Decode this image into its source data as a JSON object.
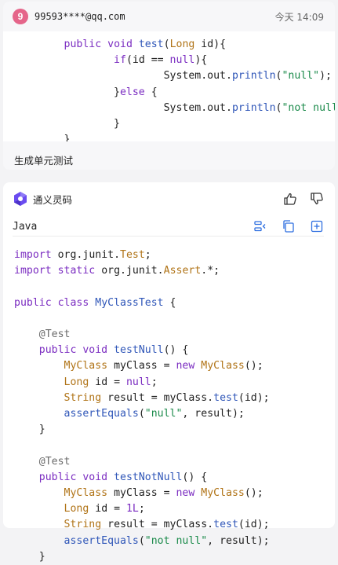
{
  "message": {
    "avatar_text": "9",
    "email": "99593****@qq.com",
    "time": "今天 14:09",
    "prompt": "生成单元测试"
  },
  "assistant": {
    "name": "通义灵码",
    "language": "Java"
  },
  "colors": {
    "keyword": "#7b2dc1",
    "function": "#2f56b8",
    "type": "#b07316",
    "string": "#1a8a4a",
    "avatar": "#e5658a"
  },
  "icons": [
    "thumbs-up-icon",
    "thumbs-down-icon",
    "insert-code-icon",
    "copy-icon",
    "new-file-icon",
    "tongyi-logo-icon"
  ],
  "source_code_lines": [
    "        public void test(Long id){",
    "                if(id == null){",
    "                        System.out.println(\"null\");",
    "                }else {",
    "                        System.out.println(\"not null\");",
    "                }",
    "        }"
  ],
  "generated_code_lines": [
    "import org.junit.Test;",
    "import static org.junit.Assert.*;",
    "",
    "public class MyClassTest {",
    "",
    "    @Test",
    "    public void testNull() {",
    "        MyClass myClass = new MyClass();",
    "        Long id = null;",
    "        String result = myClass.test(id);",
    "        assertEquals(\"null\", result);",
    "    }",
    "",
    "    @Test",
    "    public void testNotNull() {",
    "        MyClass myClass = new MyClass();",
    "        Long id = 1L;",
    "        String result = myClass.test(id);",
    "        assertEquals(\"not null\", result);",
    "    }"
  ]
}
